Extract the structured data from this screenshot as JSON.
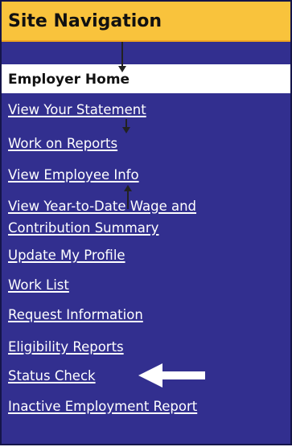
{
  "nav": {
    "title": "Site Navigation",
    "home_label": "Employer Home",
    "links": [
      {
        "label": "View Your Statement"
      },
      {
        "label": "Work on Reports"
      },
      {
        "label": "View Employee Info"
      },
      {
        "label_line1": "View Year-to-Date Wage and",
        "label_line2": "Contribution Summary"
      },
      {
        "label": "Update My Profile"
      },
      {
        "label": "Work List"
      },
      {
        "label": "Request Information"
      },
      {
        "label": "Eligibility Reports"
      },
      {
        "label": "Status Check"
      },
      {
        "label": "Inactive Employment Report"
      }
    ]
  },
  "colors": {
    "header_bg": "#f9c33c",
    "panel_bg": "#322f8f",
    "link_text": "#ffffff",
    "pointer_arrow": "#ffffff"
  },
  "annotations": {
    "highlighted_item": "Status Check",
    "pointer_icon": "left-arrow-icon"
  }
}
